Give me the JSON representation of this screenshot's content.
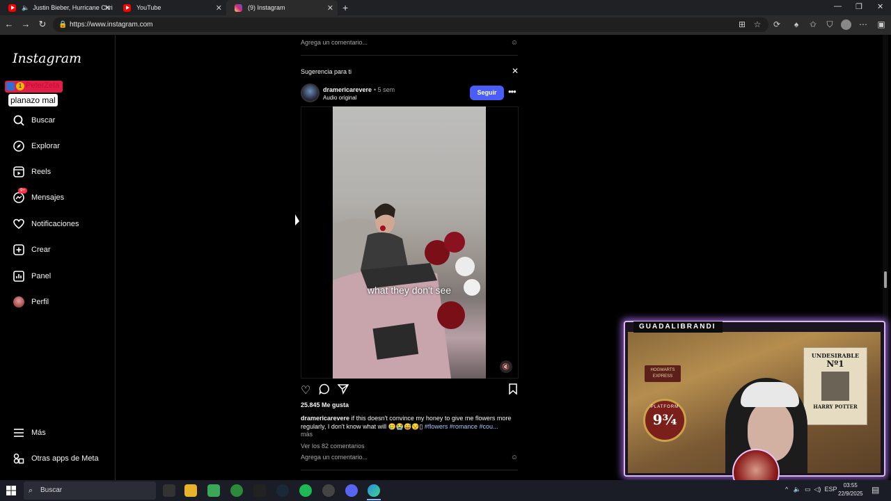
{
  "browser": {
    "tabs": [
      {
        "title": "Justin Bieber, Hurricane Chri",
        "icon": "youtube-icon",
        "color": "#ff0000"
      },
      {
        "title": "YouTube",
        "icon": "youtube-icon",
        "color": "#ff0000"
      },
      {
        "title": "(9) Instagram",
        "icon": "instagram-icon",
        "color": "#d6249f"
      }
    ],
    "url": "https://www.instagram.com"
  },
  "overlay": {
    "peter": "PeterZeta",
    "peter_badge": "1",
    "planazo": "planazo mal"
  },
  "sidebar": {
    "logo": "Instagram",
    "items": [
      {
        "label": "Buscar",
        "icon": "search-icon"
      },
      {
        "label": "Explorar",
        "icon": "compass-icon"
      },
      {
        "label": "Reels",
        "icon": "reels-icon"
      },
      {
        "label": "Mensajes",
        "icon": "messenger-icon",
        "badge": "9+"
      },
      {
        "label": "Notificaciones",
        "icon": "heart-icon"
      },
      {
        "label": "Crear",
        "icon": "plus-square-icon"
      },
      {
        "label": "Panel",
        "icon": "chart-icon"
      },
      {
        "label": "Perfil",
        "icon": "profile-avatar"
      }
    ],
    "more": "Más",
    "meta": "Otras apps de Meta"
  },
  "feed": {
    "add_comment": "Agrega un comentario...",
    "suggestion": "Sugerencia para ti",
    "post": {
      "username": "dramericarevere",
      "time": "• 5 sem",
      "audio": "Audio original",
      "follow": "Seguir",
      "video_caption": "what they don't see",
      "likes": "25.845 Me gusta",
      "caption_user": "dramericarevere",
      "caption_text": " if this doesn't convince my honey to give me flowers more regularly, I don't know what will 🥲😭😅😒▯",
      "caption_tags": "#flowers #romance #cou...",
      "more": "más",
      "view_comments": "Ver los 82 comentarios"
    }
  },
  "webcam": {
    "title": "GUADALIBRANDI",
    "hogwarts": "HOGWARTS EXPRESS",
    "platform_label": "PLATFORM",
    "platform_num": "9¾",
    "wanted_1": "UNDESIRABLE",
    "wanted_2": "Nº1",
    "wanted_3": "HARRY POTTER"
  },
  "taskbar": {
    "search": "Buscar",
    "lang": "ESP",
    "time": "03:55",
    "date": "22/9/2025"
  },
  "colors": {
    "accent": "#4a5df9",
    "badge": "#ff3040"
  }
}
